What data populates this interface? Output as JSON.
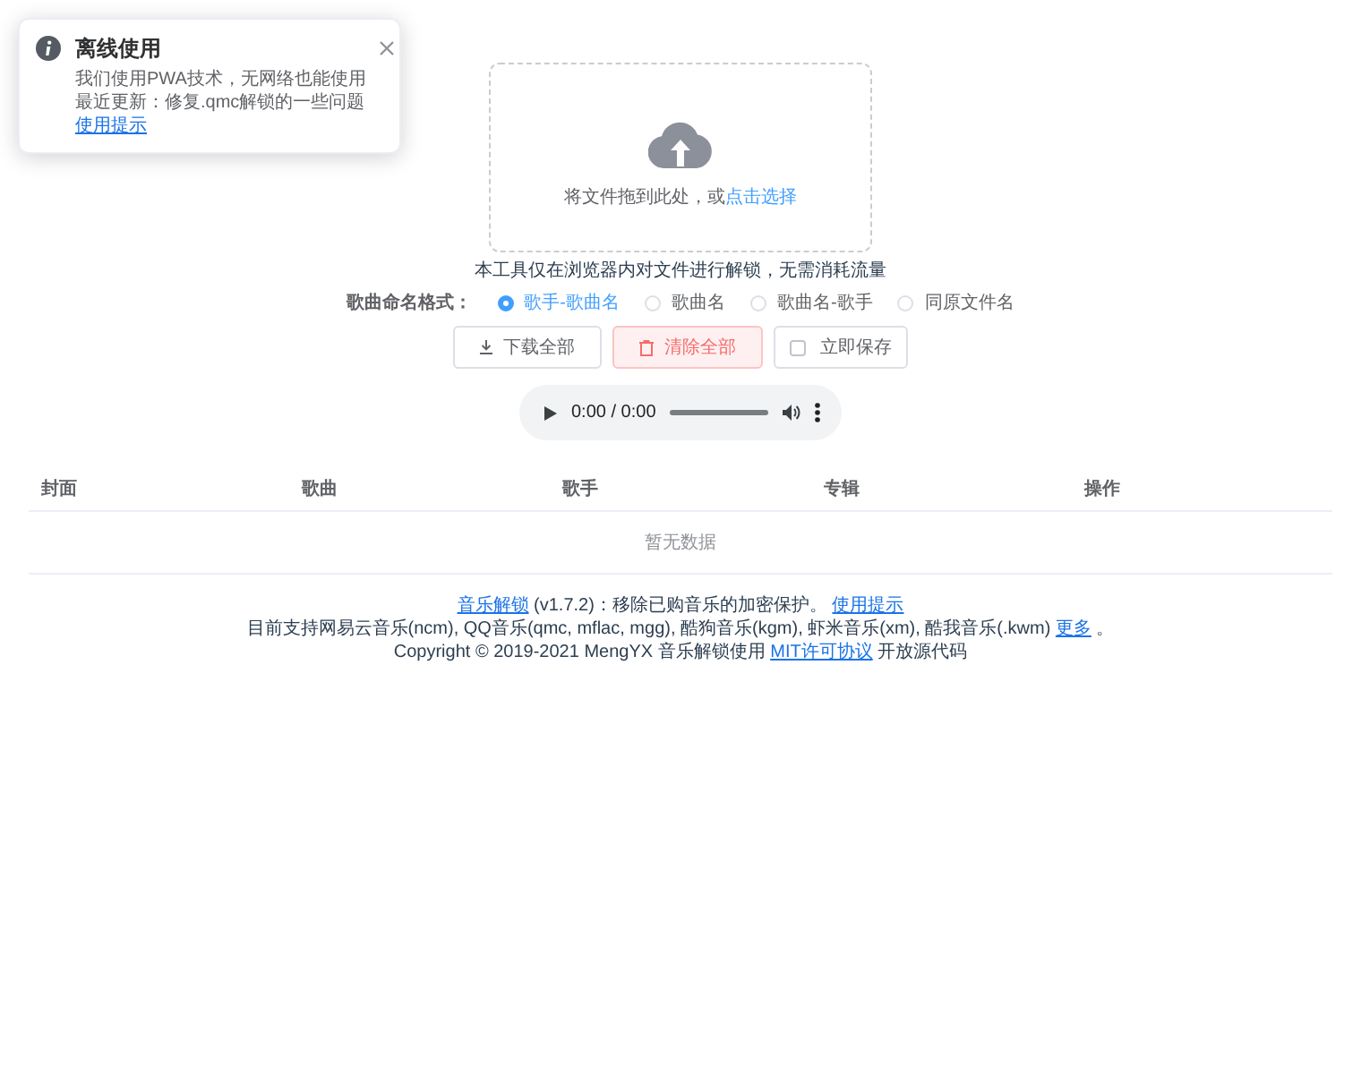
{
  "notification": {
    "title": "离线使用",
    "lines": [
      "我们使用PWA技术，无网络也能使用",
      "最近更新：修复.qmc解锁的一些问题"
    ],
    "link": "使用提示"
  },
  "upload": {
    "text": "将文件拖到此处，或",
    "link": "点击选择"
  },
  "notice": "本工具仅在浏览器内对文件进行解锁，无需消耗流量",
  "naming_format": {
    "label": "歌曲命名格式：",
    "options": [
      {
        "label": "歌手-歌曲名",
        "selected": true
      },
      {
        "label": "歌曲名",
        "selected": false
      },
      {
        "label": "歌曲名-歌手",
        "selected": false
      },
      {
        "label": "同原文件名",
        "selected": false
      }
    ]
  },
  "buttons": [
    {
      "kind": "download",
      "label": "下载全部"
    },
    {
      "kind": "clear",
      "label": "清除全部"
    }
  ],
  "instant_save": {
    "label": "立即保存",
    "checked": false
  },
  "audio_player": {
    "time": "0:00 / 0:00"
  },
  "table": {
    "columns": [
      "封面",
      "歌曲",
      "歌手",
      "专辑",
      "操作"
    ],
    "empty_text": "暂无数据"
  },
  "footer": [
    [
      {
        "kind": "link",
        "text": "音乐解锁"
      },
      {
        "kind": "text",
        "text": " (v1.7.2)：移除已购音乐的加密保护。 "
      },
      {
        "kind": "link",
        "text": "使用提示"
      }
    ],
    [
      {
        "kind": "text",
        "text": "目前支持网易云音乐(ncm), QQ音乐(qmc, mflac, mgg), 酷狗音乐(kgm), 虾米音乐(xm), 酷我音乐(.kwm) "
      },
      {
        "kind": "link",
        "text": "更多"
      },
      {
        "kind": "text",
        "text": " 。"
      }
    ],
    [
      {
        "kind": "text",
        "text": "Copyright © 2019-2021 MengYX 音乐解锁使用 "
      },
      {
        "kind": "link",
        "text": "MIT许可协议"
      },
      {
        "kind": "text",
        "text": " 开放源代码"
      }
    ]
  ]
}
